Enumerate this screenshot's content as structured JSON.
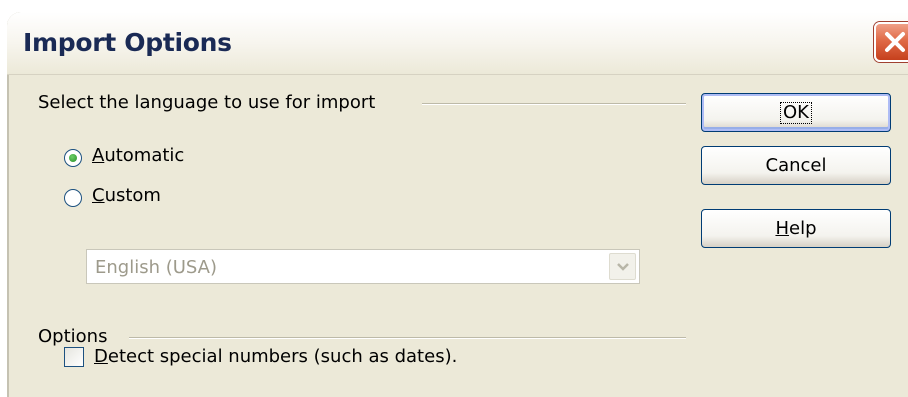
{
  "window": {
    "title": "Import Options"
  },
  "titlebar": {
    "close_icon": "close-icon",
    "close_color": "#e06a47"
  },
  "language_group": {
    "label": "Select the language to use for import",
    "automatic": {
      "accel": "A",
      "rest": "utomatic",
      "selected": true
    },
    "custom": {
      "accel": "C",
      "rest": "ustom",
      "selected": false
    },
    "language_select": {
      "value": "English (USA)",
      "enabled": false
    }
  },
  "options_group": {
    "label": "Options",
    "detect_numbers": {
      "accel": "D",
      "rest": "etect special numbers (such as dates).",
      "checked": false
    }
  },
  "buttons": {
    "ok": "OK",
    "cancel": "Cancel",
    "help_accel": "H",
    "help_rest": "elp"
  }
}
